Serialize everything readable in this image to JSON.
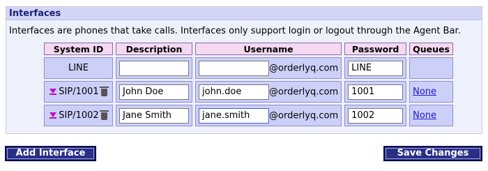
{
  "panel": {
    "title": "Interfaces",
    "description": "Interfaces are phones that take calls. Interfaces only support login or logout through the Agent Bar."
  },
  "table": {
    "headers": {
      "system_id": "System ID",
      "description": "Description",
      "username": "Username",
      "password": "Password",
      "queues": "Queues"
    },
    "rows": [
      {
        "system_id": "LINE",
        "description": "",
        "username": "",
        "domain": "@orderlyq.com",
        "password": "LINE",
        "queues": "",
        "has_controls": false
      },
      {
        "system_id": "SIP/1001",
        "description": "John Doe",
        "username": "john.doe",
        "domain": "@orderlyq.com",
        "password": "1001",
        "queues": "None",
        "has_controls": true
      },
      {
        "system_id": "SIP/1002",
        "description": "Jane Smith",
        "username": "jane.smith",
        "domain": "@orderlyq.com",
        "password": "1002",
        "queues": "None",
        "has_controls": true
      }
    ]
  },
  "buttons": {
    "add_label": "Add Interface",
    "save_label": "Save Changes"
  },
  "colors": {
    "header_bg": "#d2d6f4",
    "title_text": "#1b1f7a",
    "column_header_bg": "#f4d9f0",
    "cell_bg": "#ccd0f8",
    "button_bg": "#2a2f86",
    "link": "#1a1ad0"
  }
}
